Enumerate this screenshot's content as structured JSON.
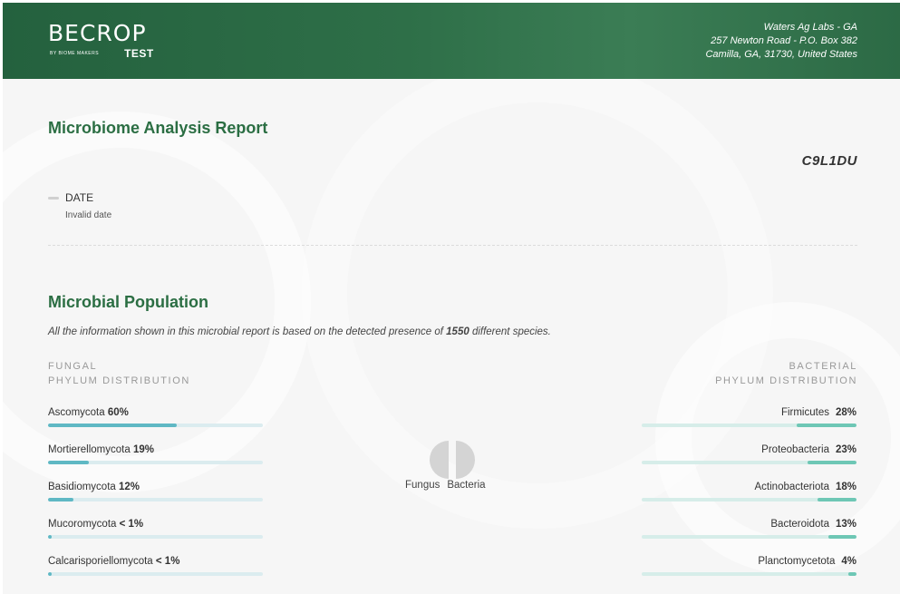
{
  "header": {
    "logo_main": "BECROP",
    "logo_sub": "BY BIOME MAKERS",
    "logo_test": "TEST",
    "lab_name": "Waters Ag Labs - GA",
    "lab_address1": "257 Newton Road - P.O. Box 382",
    "lab_address2": "Camilla, GA, 31730, United States"
  },
  "report": {
    "title": "Microbiome Analysis Report",
    "code": "C9L1DU",
    "date_label": "DATE",
    "date_value": "Invalid date"
  },
  "population": {
    "title": "Microbial Population",
    "info_prefix": "All the information shown in this microbial report is based on the detected presence of ",
    "species_count": "1550",
    "info_suffix": " different species.",
    "fungal_label_1": "FUNGAL",
    "fungal_label_2": "PHYLUM DISTRIBUTION",
    "bacterial_label_1": "BACTERIAL",
    "bacterial_label_2": "PHYLUM DISTRIBUTION",
    "fungal": [
      {
        "name": "Ascomycota",
        "pct": "60%",
        "fill": 0.6
      },
      {
        "name": "Mortierellomycota",
        "pct": "19%",
        "fill": 0.19
      },
      {
        "name": "Basidiomycota",
        "pct": "12%",
        "fill": 0.12
      },
      {
        "name": "Mucoromycota",
        "pct": "< 1%",
        "fill": 0.01
      },
      {
        "name": "Calcarisporiellomycota",
        "pct": "< 1%",
        "fill": 0.01
      }
    ],
    "bacterial": [
      {
        "name": "Firmicutes",
        "pct": "28%",
        "fill": 0.28
      },
      {
        "name": "Proteobacteria",
        "pct": "23%",
        "fill": 0.23
      },
      {
        "name": "Actinobacteriota",
        "pct": "18%",
        "fill": 0.18
      },
      {
        "name": "Bacteroidota",
        "pct": "13%",
        "fill": 0.13
      },
      {
        "name": "Planctomycetota",
        "pct": "4%",
        "fill": 0.04
      }
    ],
    "center_legend": {
      "fungus": "Fungus",
      "bacteria": "Bacteria"
    }
  },
  "colors": {
    "brand_green": "#2b6e43",
    "fungal_bar": "#5fb8c4",
    "bacterial_bar": "#6ec7b5",
    "pie_gray": "#d4d4d4"
  }
}
